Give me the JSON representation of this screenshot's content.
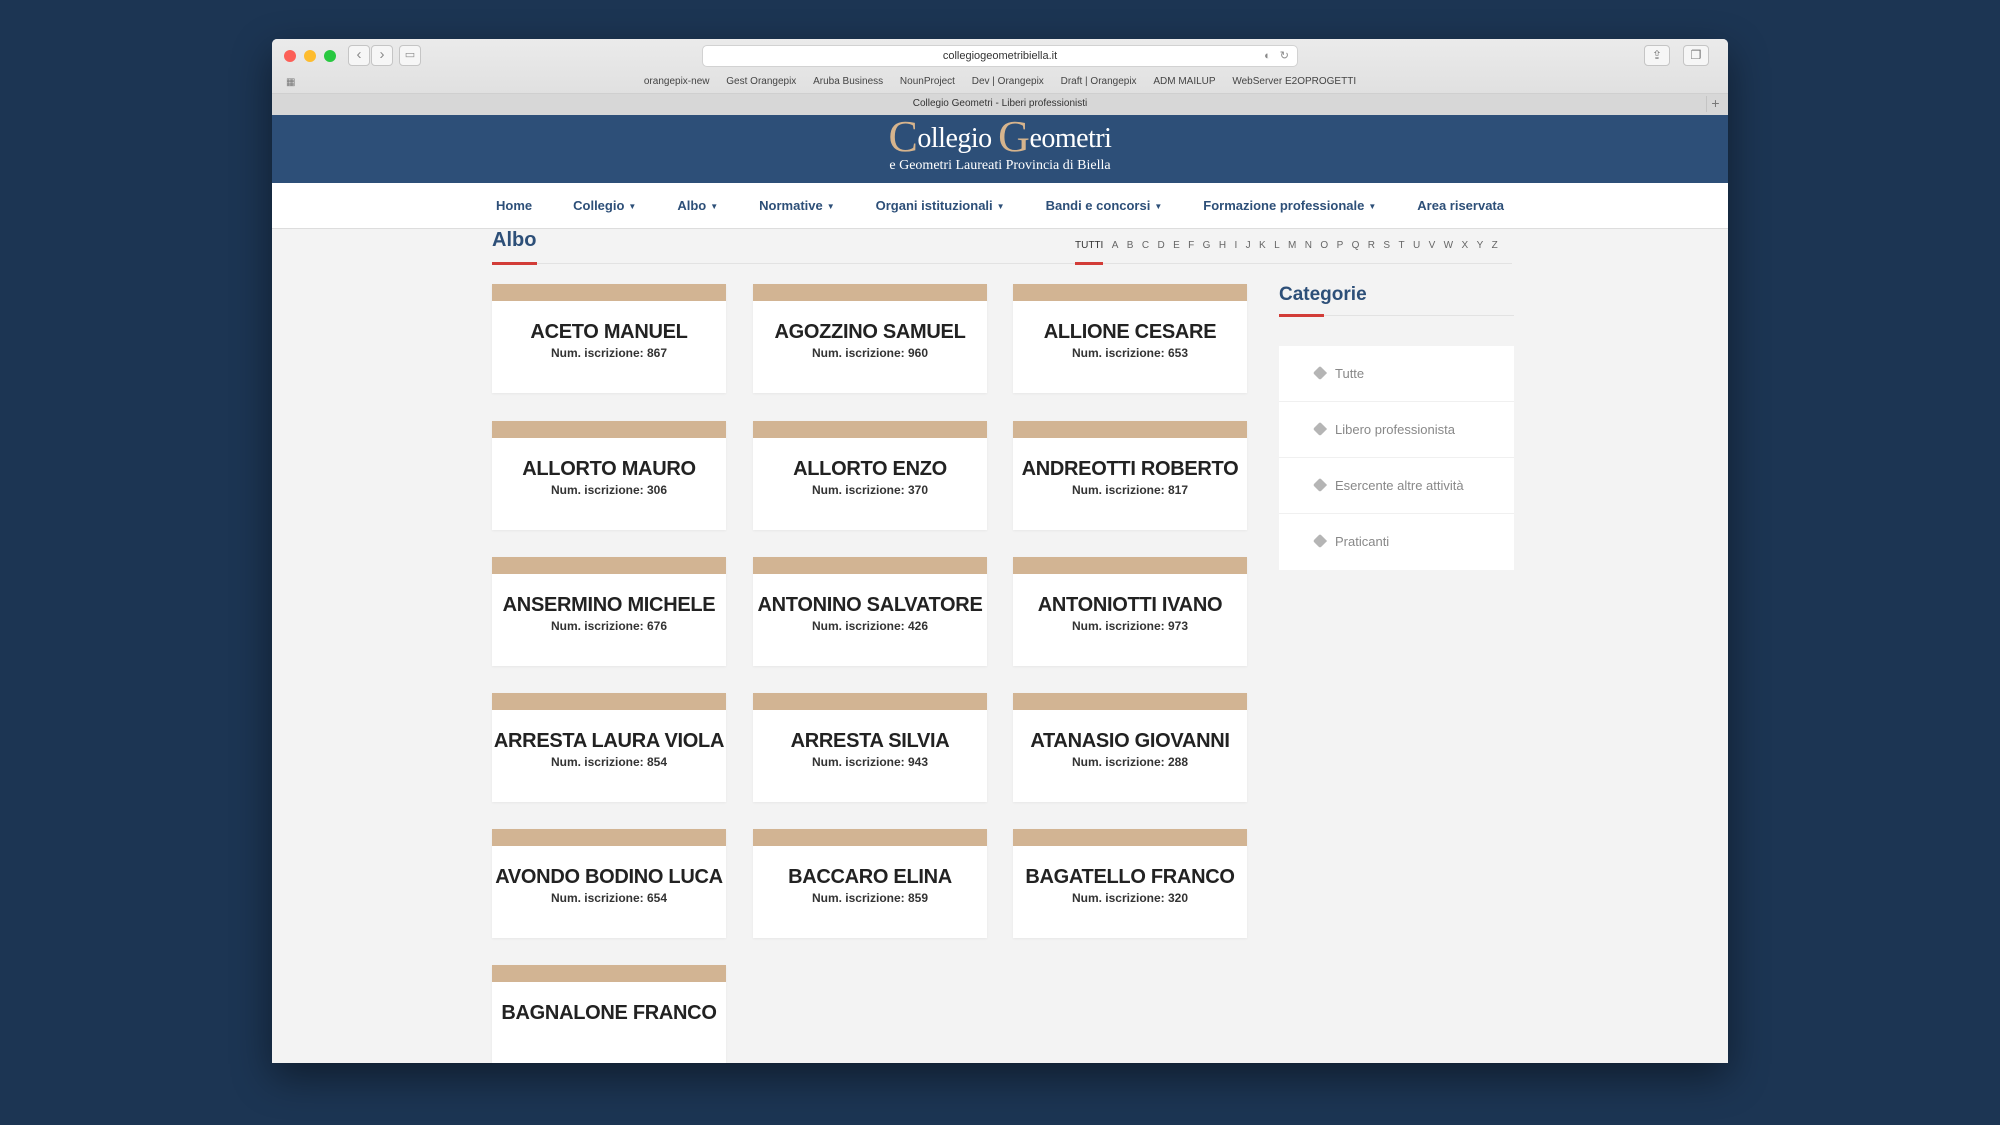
{
  "browser": {
    "url": "collegiogeometribiella.it",
    "tab_title": "Collegio Geometri - Liberi professionisti",
    "bookmarks": [
      "orangepix-new",
      "Gest Orangepix",
      "Aruba Business",
      "NounProject",
      "Dev | Orangepix",
      "Draft | Orangepix",
      "ADM MAILUP",
      "WebServer E2OPROGETTI"
    ],
    "icons": [
      "back-icon",
      "forward-icon",
      "sidebar-icon",
      "audio-icon",
      "reload-icon",
      "share-icon",
      "tabs-icon",
      "apps-grid-icon",
      "new-tab-icon"
    ],
    "traffic_colors": [
      "#fc5f57",
      "#fdbc2e",
      "#28c840"
    ]
  },
  "logo": {
    "cap1": "C",
    "word1": "ollegio",
    "cap2": "G",
    "word2": "eometri",
    "subtitle": "e Geometri Laureati Provincia di Biella"
  },
  "nav": {
    "items": [
      {
        "label": "Home",
        "dropdown": false
      },
      {
        "label": "Collegio",
        "dropdown": true
      },
      {
        "label": "Albo",
        "dropdown": true
      },
      {
        "label": "Normative",
        "dropdown": true
      },
      {
        "label": "Organi istituzionali",
        "dropdown": true
      },
      {
        "label": "Bandi e concorsi",
        "dropdown": true
      },
      {
        "label": "Formazione professionale",
        "dropdown": true
      },
      {
        "label": "Area riservata",
        "dropdown": false
      }
    ],
    "caret": "▼"
  },
  "page": {
    "title": "Albo",
    "alpha_all": "TUTTI",
    "letters": [
      "A",
      "B",
      "C",
      "D",
      "E",
      "F",
      "G",
      "H",
      "I",
      "J",
      "K",
      "L",
      "M",
      "N",
      "O",
      "P",
      "Q",
      "R",
      "S",
      "T",
      "U",
      "V",
      "W",
      "X",
      "Y",
      "Z"
    ]
  },
  "members": [
    {
      "name": "ACETO MANUEL",
      "num": "Num. iscrizione: 867"
    },
    {
      "name": "AGOZZINO SAMUEL",
      "num": "Num. iscrizione: 960"
    },
    {
      "name": "ALLIONE CESARE",
      "num": "Num. iscrizione: 653"
    },
    {
      "name": "ALLORTO MAURO",
      "num": "Num. iscrizione: 306"
    },
    {
      "name": "ALLORTO ENZO",
      "num": "Num. iscrizione: 370"
    },
    {
      "name": "ANDREOTTI ROBERTO",
      "num": "Num. iscrizione: 817"
    },
    {
      "name": "ANSERMINO MICHELE",
      "num": "Num. iscrizione: 676"
    },
    {
      "name": "ANTONINO SALVATORE",
      "num": "Num. iscrizione: 426"
    },
    {
      "name": "ANTONIOTTI IVANO",
      "num": "Num. iscrizione: 973"
    },
    {
      "name": "ARRESTA LAURA VIOLA",
      "num": "Num. iscrizione: 854"
    },
    {
      "name": "ARRESTA SILVIA",
      "num": "Num. iscrizione: 943"
    },
    {
      "name": "ATANASIO GIOVANNI",
      "num": "Num. iscrizione: 288"
    },
    {
      "name": "AVONDO BODINO LUCA",
      "num": "Num. iscrizione: 654"
    },
    {
      "name": "BACCARO ELINA",
      "num": "Num. iscrizione: 859"
    },
    {
      "name": "BAGATELLO FRANCO",
      "num": "Num. iscrizione: 320"
    },
    {
      "name": "BAGNALONE FRANCO",
      "num": ""
    }
  ],
  "sidebar": {
    "title": "Categorie",
    "categories": [
      "Tutte",
      "Libero professionista",
      "Esercente altre attività",
      "Praticanti"
    ],
    "icon": "tag-icon"
  },
  "colors": {
    "background": "#1c3553",
    "header": "#2d4f78",
    "accent_red": "#d23c37",
    "card_band": "#d2b493",
    "logo_gold": "#d6b48d"
  }
}
